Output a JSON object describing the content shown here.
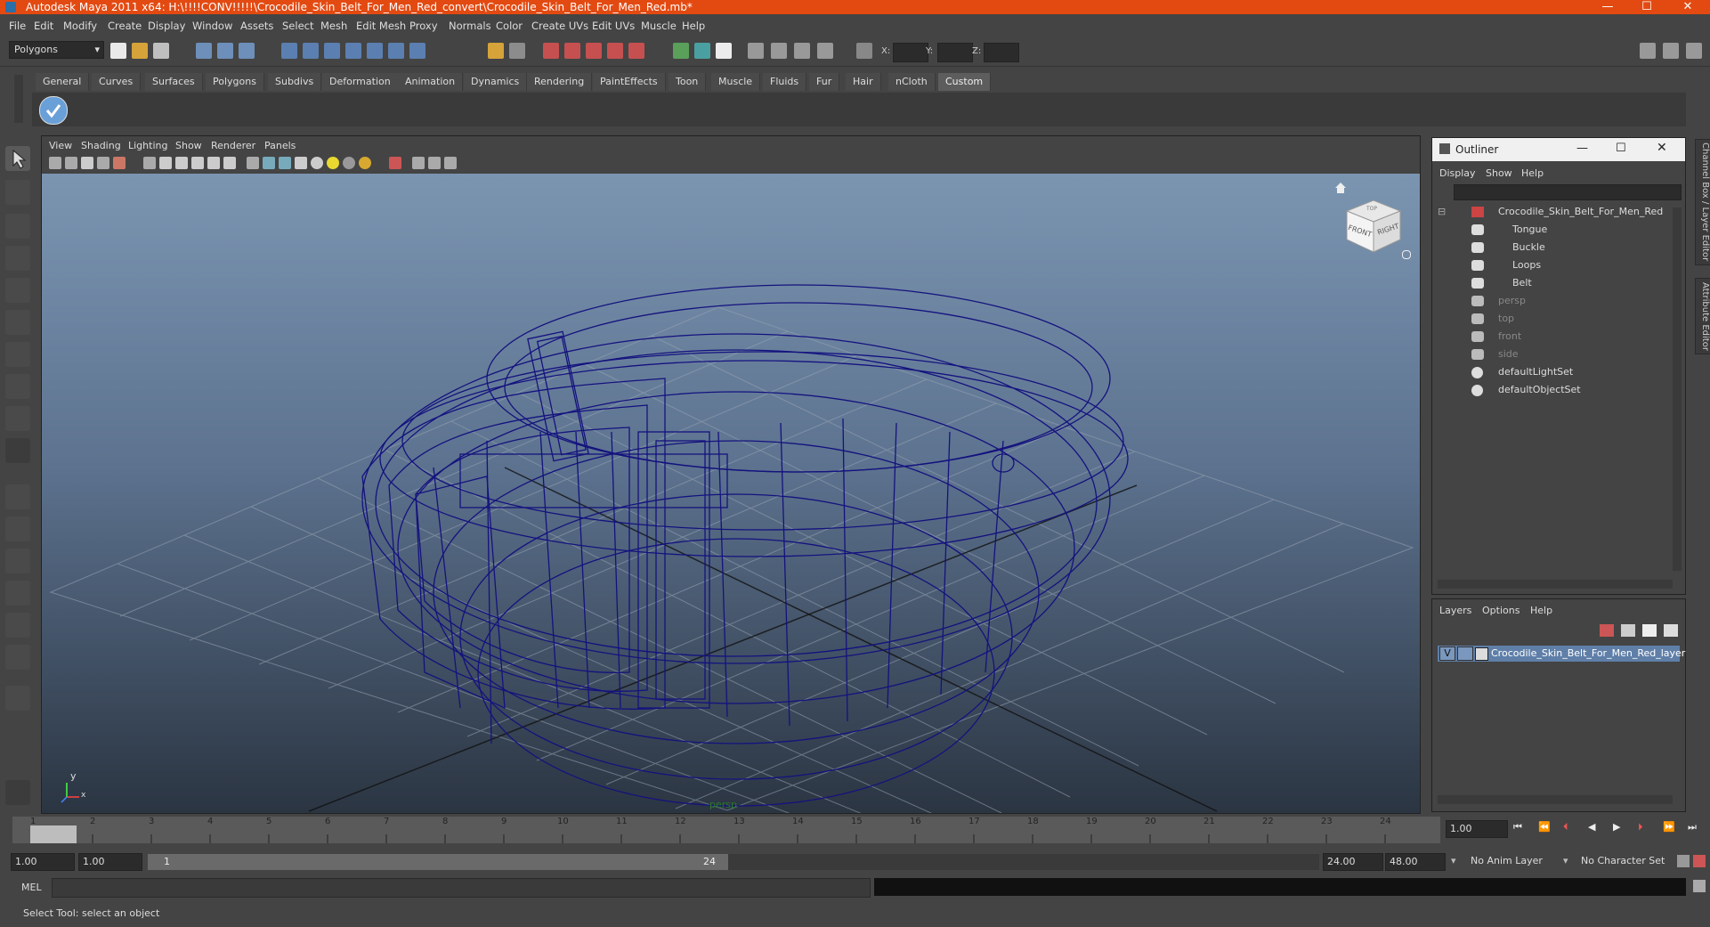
{
  "window": {
    "title": "Autodesk Maya 2011 x64: H:\\!!!!CONV!!!!!\\Crocodile_Skin_Belt_For_Men_Red_convert\\Crocodile_Skin_Belt_For_Men_Red.mb*",
    "minimize": "—",
    "maximize": "☐",
    "close": "✕"
  },
  "menus": [
    "File",
    "Edit",
    "Modify",
    "Create",
    "Display",
    "Window",
    "Assets",
    "Select",
    "Mesh",
    "Edit Mesh",
    "Proxy",
    "Normals",
    "Color",
    "Create UVs",
    "Edit UVs",
    "Muscle",
    "Help"
  ],
  "status_line": {
    "mode": "Polygons",
    "x_label": "X:",
    "y_label": "Y:",
    "z_label": "Z:"
  },
  "shelf_tabs": [
    "General",
    "Curves",
    "Surfaces",
    "Polygons",
    "Subdivs",
    "Deformation",
    "Animation",
    "Dynamics",
    "Rendering",
    "PaintEffects",
    "Toon",
    "Muscle",
    "Fluids",
    "Fur",
    "Hair",
    "nCloth",
    "Custom"
  ],
  "viewport": {
    "menus": [
      "View",
      "Shading",
      "Lighting",
      "Show",
      "Renderer",
      "Panels"
    ],
    "camera_label": "persp",
    "viewcube_front": "FRONT",
    "viewcube_right": "RIGHT",
    "viewcube_top": "TOP",
    "axis_y": "y",
    "axis_x": "x"
  },
  "outliner": {
    "title": "Outliner",
    "menus": [
      "Display",
      "Show",
      "Help"
    ],
    "items": [
      {
        "label": "Crocodile_Skin_Belt_For_Men_Red",
        "indent": 0,
        "dim": false
      },
      {
        "label": "Tongue",
        "indent": 1,
        "dim": false
      },
      {
        "label": "Buckle",
        "indent": 1,
        "dim": false
      },
      {
        "label": "Loops",
        "indent": 1,
        "dim": false
      },
      {
        "label": "Belt",
        "indent": 1,
        "dim": false
      },
      {
        "label": "persp",
        "indent": 0,
        "dim": true
      },
      {
        "label": "top",
        "indent": 0,
        "dim": true
      },
      {
        "label": "front",
        "indent": 0,
        "dim": true
      },
      {
        "label": "side",
        "indent": 0,
        "dim": true
      },
      {
        "label": "defaultLightSet",
        "indent": 0,
        "dim": false
      },
      {
        "label": "defaultObjectSet",
        "indent": 0,
        "dim": false
      }
    ]
  },
  "layers": {
    "menus": [
      "Layers",
      "Options",
      "Help"
    ],
    "visible_flag": "V",
    "layer_name": "Crocodile_Skin_Belt_For_Men_Red_layer"
  },
  "side_tabs": {
    "channel_box": "Channel Box / Layer Editor",
    "attribute_editor": "Attribute Editor"
  },
  "timeline": {
    "ticks": [
      "1",
      "2",
      "3",
      "4",
      "5",
      "6",
      "7",
      "8",
      "9",
      "10",
      "11",
      "12",
      "13",
      "14",
      "15",
      "16",
      "17",
      "18",
      "19",
      "20",
      "21",
      "22",
      "23",
      "24"
    ],
    "current_frame": "1.00"
  },
  "range": {
    "start": "1.00",
    "playback_start": "1.00",
    "slider_start": "1",
    "slider_end": "24",
    "playback_end": "24.00",
    "end": "48.00",
    "anim_layer": "No Anim Layer",
    "character_set": "No Character Set"
  },
  "command_line": {
    "label": "MEL"
  },
  "help_line": {
    "text": "Select Tool: select an object"
  }
}
